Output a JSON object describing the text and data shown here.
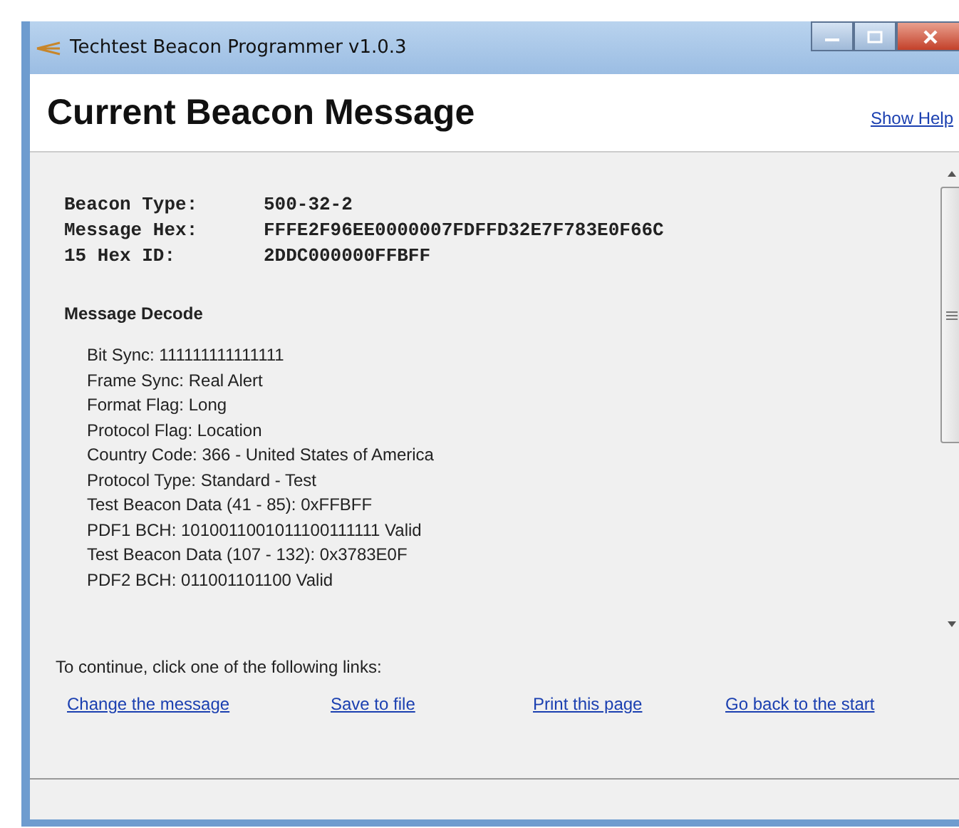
{
  "window": {
    "title": "Techtest Beacon Programmer v1.0.3"
  },
  "header": {
    "title": "Current Beacon Message",
    "help_link": "Show Help"
  },
  "summary": [
    {
      "label": "Beacon Type:",
      "value": "500-32-2"
    },
    {
      "label": "Message Hex:",
      "value": "FFFE2F96EE0000007FDFFD32E7F783E0F66C"
    },
    {
      "label": "15 Hex ID:",
      "value": "2DDC000000FFBFF"
    }
  ],
  "decode": {
    "heading": "Message Decode",
    "lines": [
      "Bit Sync: 111111111111111",
      "Frame Sync: Real Alert",
      "Format Flag: Long",
      "Protocol Flag: Location",
      "Country Code: 366 - United States of America",
      "Protocol Type: Standard - Test",
      "Test Beacon Data (41 - 85): 0xFFBFF",
      "PDF1 BCH: 1010011001011100111111 Valid",
      "Test Beacon Data (107 - 132): 0x3783E0F",
      "PDF2 BCH: 011001101100 Valid"
    ]
  },
  "footer": {
    "prompt": "To continue, click one of the following links:",
    "links": [
      "Change the message",
      "Save to file",
      "Print this page",
      "Go back to the start"
    ]
  }
}
